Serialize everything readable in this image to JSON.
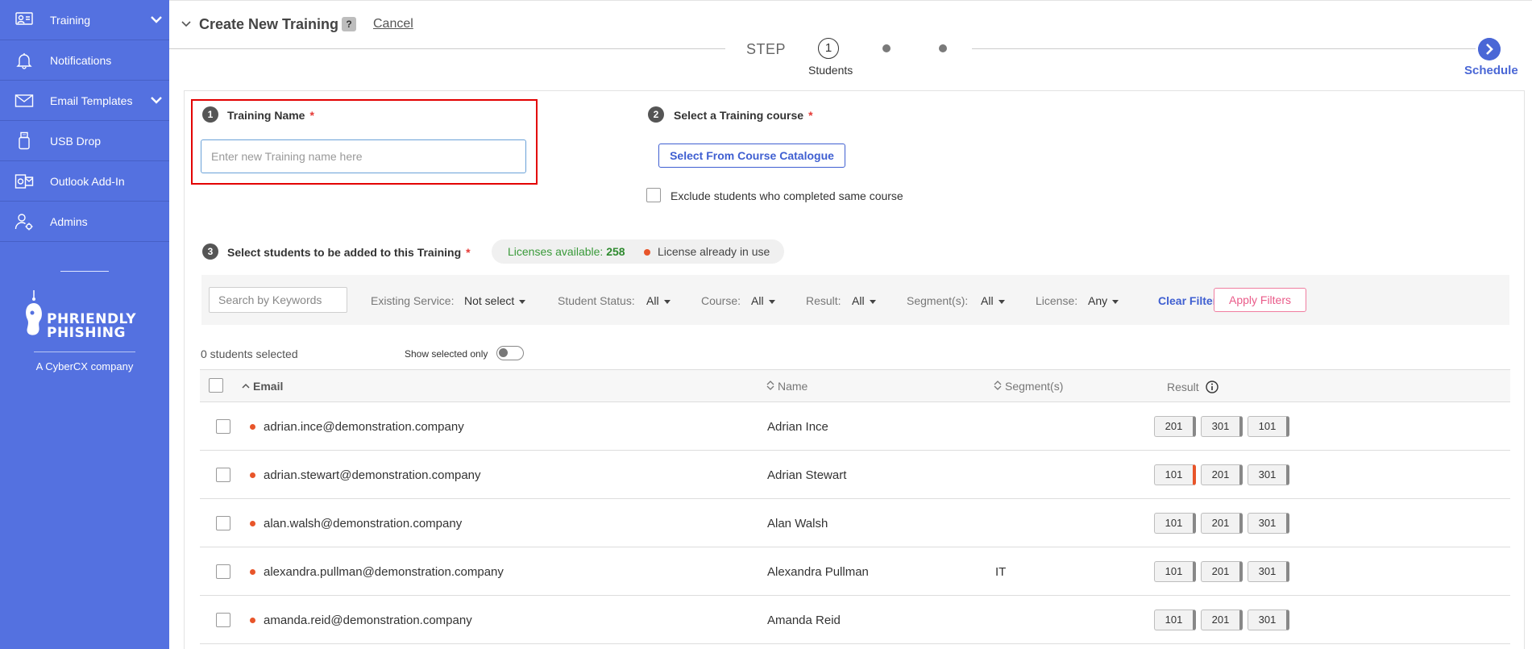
{
  "sidebar": {
    "items": [
      {
        "label": "Training",
        "icon": "training-icon",
        "has_chevron": true
      },
      {
        "label": "Notifications",
        "icon": "bell-icon",
        "has_chevron": false
      },
      {
        "label": "Email Templates",
        "icon": "envelope-icon",
        "has_chevron": true
      },
      {
        "label": "USB Drop",
        "icon": "usb-icon",
        "has_chevron": false
      },
      {
        "label": "Outlook Add-In",
        "icon": "outlook-icon",
        "has_chevron": false
      },
      {
        "label": "Admins",
        "icon": "admins-icon",
        "has_chevron": false
      }
    ],
    "brand_line1": "PHRIENDLY",
    "brand_line2": "PHISHING",
    "tagline": "A CyberCX company"
  },
  "header": {
    "title": "Create New Training",
    "help": "?",
    "cancel": "Cancel"
  },
  "stepper": {
    "label": "STEP",
    "current_number": "1",
    "current_name": "Students",
    "last_name": "Schedule"
  },
  "form": {
    "name_section": {
      "number": "1",
      "label": "Training Name",
      "required": "*",
      "placeholder": "Enter new Training name here"
    },
    "course_section": {
      "number": "2",
      "label": "Select a Training course",
      "required": "*",
      "button": "Select From Course Catalogue",
      "exclude_label": "Exclude students who completed same course"
    },
    "students_section": {
      "number": "3",
      "label": "Select students to be added to this Training",
      "required": "*"
    }
  },
  "license": {
    "available_label": "Licenses available: ",
    "available_count": "258",
    "in_use_label": "License already in use"
  },
  "filters": {
    "search_placeholder": "Search by Keywords",
    "existing_service": {
      "label": "Existing Service:",
      "value": "Not select"
    },
    "student_status": {
      "label": "Student Status:",
      "value": "All"
    },
    "course": {
      "label": "Course:",
      "value": "All"
    },
    "result": {
      "label": "Result:",
      "value": "All"
    },
    "segments": {
      "label": "Segment(s):",
      "value": "All"
    },
    "license": {
      "label": "License:",
      "value": "Any"
    },
    "clear": "Clear Filters",
    "apply": "Apply Filters"
  },
  "selection": {
    "count_text": "0 students selected",
    "show_selected": "Show selected only"
  },
  "table": {
    "headers": {
      "email": "Email",
      "name": "Name",
      "segments": "Segment(s)",
      "result": "Result"
    },
    "rows": [
      {
        "email": "adrian.ince@demonstration.company",
        "name": "Adrian Ince",
        "segment": "",
        "results": [
          "201",
          "301",
          "101"
        ],
        "orange_index": -1
      },
      {
        "email": "adrian.stewart@demonstration.company",
        "name": "Adrian Stewart",
        "segment": "",
        "results": [
          "101",
          "201",
          "301"
        ],
        "orange_index": 0
      },
      {
        "email": "alan.walsh@demonstration.company",
        "name": "Alan Walsh",
        "segment": "",
        "results": [
          "101",
          "201",
          "301"
        ],
        "orange_index": -1
      },
      {
        "email": "alexandra.pullman@demonstration.company",
        "name": "Alexandra Pullman",
        "segment": "IT",
        "results": [
          "101",
          "201",
          "301"
        ],
        "orange_index": -1
      },
      {
        "email": "amanda.reid@demonstration.company",
        "name": "Amanda Reid",
        "segment": "",
        "results": [
          "101",
          "201",
          "301"
        ],
        "orange_index": -1
      }
    ]
  },
  "colors": {
    "sidebar": "#5471e0",
    "accent": "#3f5fd1",
    "danger": "#e30000",
    "license_dot": "#e8552a"
  }
}
